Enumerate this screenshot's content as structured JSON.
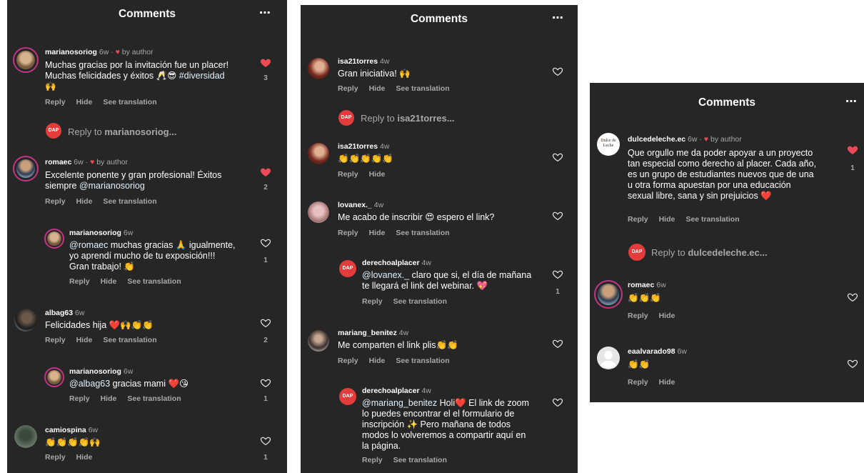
{
  "header_title": "Comments",
  "more_icon": "⋯",
  "labels": {
    "reply": "Reply",
    "hide": "Hide",
    "see_translation": "See translation",
    "by_author": "by author",
    "reply_to": "Reply to"
  },
  "panel1": {
    "c1": {
      "user": "marianosoriog",
      "time": "6w",
      "text1": "Muchas gracias por la invitación fue un placer!",
      "text2": "Muchas felicidades y éxitos 🥂😎 ",
      "tag": "#diversidad",
      "text3": "🙌",
      "likes": "3"
    },
    "reply1": "marianosoriog...",
    "c2": {
      "user": "romaec",
      "time": "6w",
      "text1": "Excelente ponente y gran profesional! Éxitos",
      "text2": "siempre ",
      "mention": "@marianosoriog",
      "likes": "2"
    },
    "c3": {
      "user": "marianosoriog",
      "time": "6w",
      "mention": "@romaec",
      "text1": " muchas gracias 🙏 igualmente,",
      "text2": "yo aprendí mucho de tu exposición!!!",
      "text3": "Gran trabajo! 👏",
      "likes": "1"
    },
    "c4": {
      "user": "albag63",
      "time": "6w",
      "text": "Felicidades hija ❤️🙌👏👏",
      "likes": "2"
    },
    "c5": {
      "user": "marianosoriog",
      "time": "6w",
      "mention": "@albag63",
      "text": " gracias mami ❤️😘",
      "likes": "1"
    },
    "c6": {
      "user": "camiospina",
      "time": "6w",
      "text": "👏👏👏👏🙌",
      "likes": "1"
    }
  },
  "panel2": {
    "c1": {
      "user": "isa21torres",
      "time": "4w",
      "text": "Gran iniciativa! 🙌"
    },
    "reply1": "isa21torres...",
    "c2": {
      "user": "isa21torres",
      "time": "4w",
      "text": "👏👏👏👏👏"
    },
    "c3": {
      "user": "lovanex._",
      "time": "4w",
      "text": "Me acabo de inscribir 😍 espero el link?"
    },
    "c4": {
      "user": "derechoalplacer",
      "time": "4w",
      "mention": "@lovanex._",
      "text1": " claro que si, el día de mañana",
      "text2": "te llegará el link del webinar. 💖",
      "likes": "1"
    },
    "c5": {
      "user": "mariang_benitez",
      "time": "4w",
      "text": "Me comparten el link plis👏👏"
    },
    "c6": {
      "user": "derechoalplacer",
      "time": "4w",
      "mention": "@mariang_benitez",
      "text1": " Holi❤️ El link de zoom",
      "text2": "lo puedes encontrar el el formulario de",
      "text3": "inscripción ✨ Pero mañana de todos",
      "text4": "modos lo volveremos a compartir aquí en",
      "text5": "la página."
    }
  },
  "panel3": {
    "c1": {
      "user": "dulcedeleche.ec",
      "time": "6w",
      "text1": "Que orgullo me da poder apoyar a un proyecto",
      "text2": "tan especial como derecho al placer. Cada año,",
      "text3": "es un grupo de estudiantes nuevos que de una",
      "text4": "u otra forma apuestan por una educación",
      "text5": "sexual libre, sana y sin prejuicios ❤️",
      "likes": "1",
      "logo_text": "Dulce de Leche"
    },
    "reply1": "dulcedeleche.ec...",
    "c2": {
      "user": "romaec",
      "time": "6w",
      "text": "👏👏👏"
    },
    "c3": {
      "user": "eaalvarado98",
      "time": "6w",
      "text": "👏👏"
    }
  },
  "dap_logo": "DAP",
  "colors": {
    "bg": "#262626",
    "heart": "#ed4956",
    "muted": "#a8a8a8",
    "mention": "#e0f1ff"
  }
}
